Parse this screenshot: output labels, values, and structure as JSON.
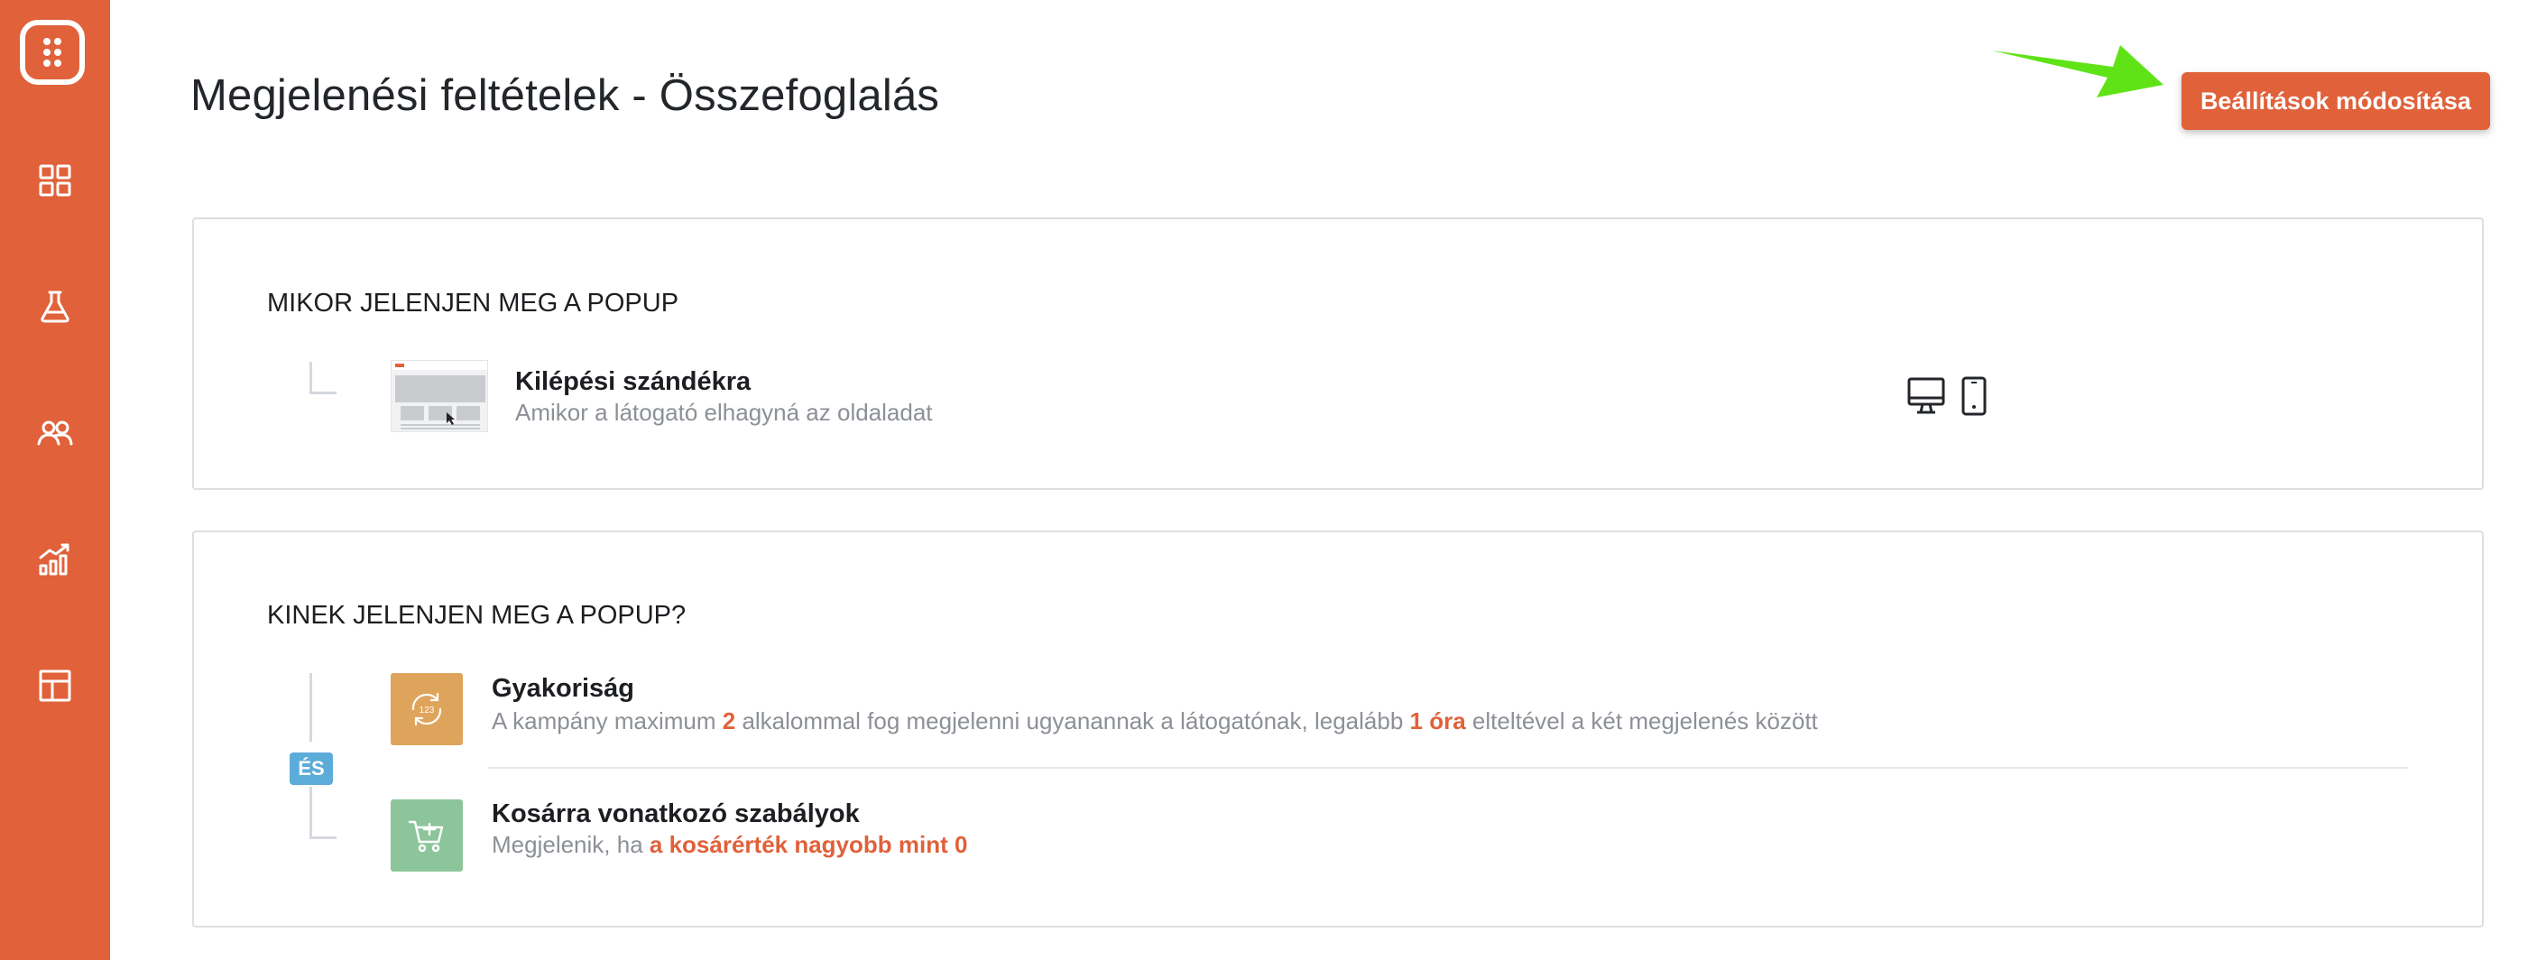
{
  "page": {
    "title": "Megjelenési feltételek - Összefoglalás",
    "edit_button": "Beállítások módosítása"
  },
  "colors": {
    "brand": "#e0613a",
    "frequency_icon_bg": "#dfa45c",
    "cart_icon_bg": "#8dc59b",
    "and_badge_bg": "#5cacd9",
    "annotation_arrow": "#5fe316"
  },
  "sidebar": {
    "items": [
      {
        "icon": "logo-icon"
      },
      {
        "icon": "dashboard-grid-icon"
      },
      {
        "icon": "flask-icon"
      },
      {
        "icon": "users-icon"
      },
      {
        "icon": "analytics-icon"
      },
      {
        "icon": "layout-icon"
      }
    ]
  },
  "when_section": {
    "heading": "MIKOR JELENJEN MEG A POPUP",
    "rule": {
      "title": "Kilépési szándékra",
      "description": "Amikor a látogató elhagyná az oldaladat",
      "devices": [
        "desktop-icon",
        "mobile-icon"
      ]
    }
  },
  "who_section": {
    "heading": "KINEK JELENJEN MEG A POPUP?",
    "and_label": "ÉS",
    "frequency": {
      "title": "Gyakoriság",
      "desc_part1": "A kampány maximum ",
      "count": "2",
      "desc_part2": " alkalommal fog megjelenni ugyanannak a látogatónak, legalább ",
      "interval": "1 óra",
      "desc_part3": " elteltével a két megjelenés között"
    },
    "cart": {
      "title": "Kosárra vonatkozó szabályok",
      "desc_part1": "Megjelenik, ha ",
      "condition": "a kosárérték nagyobb mint 0"
    }
  }
}
